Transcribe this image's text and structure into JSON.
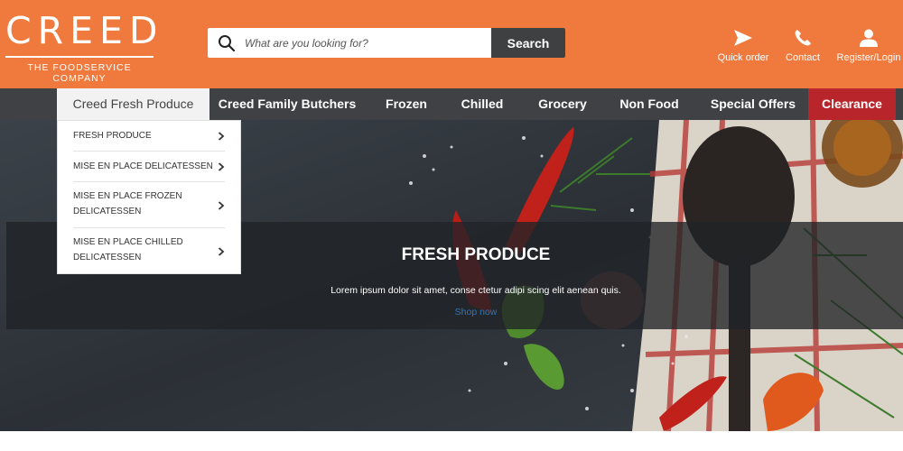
{
  "brand": {
    "name": "CREED",
    "tagline": "THE FOODSERVICE COMPANY",
    "color": "#f07a3d"
  },
  "search": {
    "placeholder": "What are you looking for?",
    "value": "",
    "button_label": "Search"
  },
  "header_links": [
    {
      "label": "Quick order",
      "icon": "paper-plane-icon"
    },
    {
      "label": "Contact",
      "icon": "phone-icon"
    },
    {
      "label": "Register/Login",
      "icon": "user-icon"
    }
  ],
  "nav": {
    "items": [
      {
        "label": "Creed Fresh Produce",
        "state": "active"
      },
      {
        "label": "Creed Family Butchers"
      },
      {
        "label": "Frozen"
      },
      {
        "label": "Chilled"
      },
      {
        "label": "Grocery"
      },
      {
        "label": "Non Food"
      },
      {
        "label": "Special Offers"
      },
      {
        "label": "Clearance",
        "accent": "#b8262b"
      }
    ]
  },
  "dropdown": {
    "items": [
      {
        "line1": "FRESH PRODUCE",
        "line2": ""
      },
      {
        "line1": "MISE EN PLACE DELICATESSEN",
        "line2": ""
      },
      {
        "line1": "MISE EN PLACE FROZEN",
        "line2": "DELICATESSEN"
      },
      {
        "line1": "MISE EN PLACE CHILLED",
        "line2": "DELICATESSEN"
      }
    ]
  },
  "hero": {
    "title": "FRESH PRODUCE",
    "text": "Lorem ipsum dolor sit amet, conse ctetur adipi scing elit aenean quis.",
    "link": "Shop now"
  }
}
